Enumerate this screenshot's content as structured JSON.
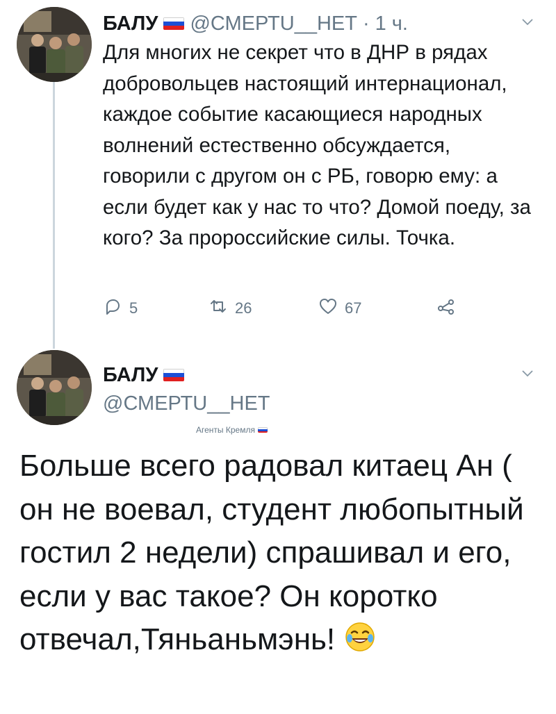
{
  "tweet1": {
    "author_name": "БАЛУ",
    "handle": "@СМЕРТU__НЕТ",
    "separator": "·",
    "time": "1 ч.",
    "text": "Для многих не секрет что в ДНР в рядах добровольцев настоящий интернационал, каждое событие касающиеся народных волнений естественно обсуждается, говорили с другом он с РБ, говорю ему: а если будет как у нас то что? Домой поеду, за кого? За пророссийские силы. Точка.",
    "actions": {
      "reply_count": "5",
      "retweet_count": "26",
      "like_count": "67"
    }
  },
  "tweet2": {
    "author_name": "БАЛУ",
    "handle": "@СМЕРТU__НЕТ",
    "bio": "Агенты Кремля",
    "text": "Больше всего радовал китаец Ан  ( он не воевал, студент любопытный гостил 2 недели) спрашивал и его, если у вас такое? Он коротко отвечал,Тяньаньмэнь!"
  },
  "icons": {
    "flag": "russia-flag-icon",
    "chevron": "chevron-down-icon",
    "reply": "reply-icon",
    "retweet": "retweet-icon",
    "like": "heart-icon",
    "share": "share-icon",
    "emoji": "tears-of-joy-emoji"
  },
  "colors": {
    "text": "#14171a",
    "secondary": "#657786",
    "thread_line": "#ccd6dd",
    "flag_blue": "#1c4fd6",
    "flag_red": "#e02020"
  }
}
